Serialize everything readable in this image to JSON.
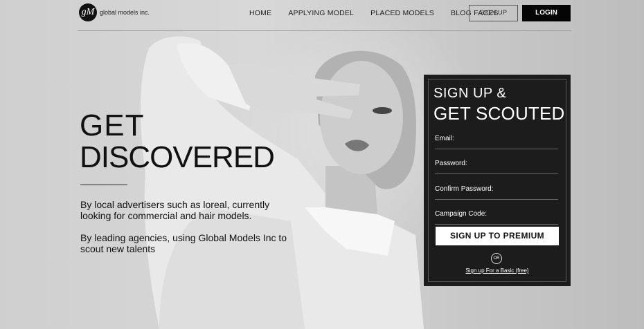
{
  "brand": {
    "logo_mark": "gM",
    "name": "global models inc."
  },
  "nav": {
    "items": [
      {
        "label": "HOME"
      },
      {
        "label": "APPLYING MODEL"
      },
      {
        "label": "PLACED MODELS"
      },
      {
        "label": "BLOG FACES"
      }
    ],
    "signup_label": "SIGN UP",
    "login_label": "LOGIN"
  },
  "hero": {
    "headline_line1": "GET",
    "headline_line2": "DISCOVERED",
    "paragraph1": "By local advertisers such as loreal, currently looking for commercial and hair models.",
    "paragraph2": "By leading agencies, using Global Models Inc to  scout new talents"
  },
  "signup_panel": {
    "title_line1": "SIGN UP &",
    "title_line2": "GET SCOUTED",
    "fields": [
      {
        "label": "Email:"
      },
      {
        "label": "Password:"
      },
      {
        "label": "Confirm Password:"
      },
      {
        "label": "Campaign Code:"
      }
    ],
    "submit_label": "SIGN UP TO PREMIUM",
    "or_label": "OR",
    "basic_link": "Sign up For a Basic (free)"
  },
  "colors": {
    "panel_bg": "#1c1c1c",
    "login_bg": "#050505",
    "accent_text": "#111111"
  }
}
